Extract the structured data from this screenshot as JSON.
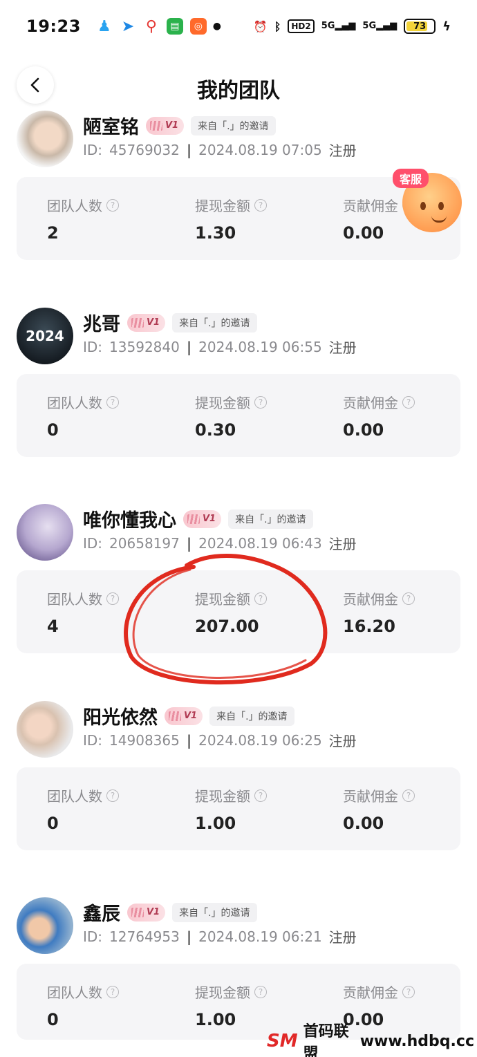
{
  "statusbar": {
    "time": "19:23",
    "notif_icons": [
      "qq-icon",
      "arrow-icon",
      "map-pin-icon",
      "message-icon",
      "app-icon",
      "dot-icon"
    ],
    "hd": "HD2",
    "sig1": "5G",
    "sig2": "5G",
    "battery": "73",
    "battery_level": 0.73
  },
  "header": {
    "title": "我的团队"
  },
  "customer_service": {
    "label": "客服"
  },
  "stat_labels": {
    "team_count": "团队人数",
    "withdraw": "提现金额",
    "commission": "贡献佣金"
  },
  "members": [
    {
      "name": "陋室铭",
      "level": "V1",
      "invite": "来自「.」的邀请",
      "id_label": "ID:",
      "id": "45769032",
      "sep": "|",
      "datetime": "2024.08.19 07:05",
      "reg": "注册",
      "team_count": "2",
      "withdraw": "1.30",
      "commission": "0.00",
      "avatar_text": ""
    },
    {
      "name": "兆哥",
      "level": "V1",
      "invite": "来自「.」的邀请",
      "id_label": "ID:",
      "id": "13592840",
      "sep": "|",
      "datetime": "2024.08.19 06:55",
      "reg": "注册",
      "team_count": "0",
      "withdraw": "0.30",
      "commission": "0.00",
      "avatar_text": "2024"
    },
    {
      "name": "唯你懂我心",
      "level": "V1",
      "invite": "来自「.」的邀请",
      "id_label": "ID:",
      "id": "20658197",
      "sep": "|",
      "datetime": "2024.08.19 06:43",
      "reg": "注册",
      "team_count": "4",
      "withdraw": "207.00",
      "commission": "16.20",
      "avatar_text": ""
    },
    {
      "name": "阳光依然",
      "level": "V1",
      "invite": "来自「.」的邀请",
      "id_label": "ID:",
      "id": "14908365",
      "sep": "|",
      "datetime": "2024.08.19 06:25",
      "reg": "注册",
      "team_count": "0",
      "withdraw": "1.00",
      "commission": "0.00",
      "avatar_text": ""
    },
    {
      "name": "鑫辰",
      "level": "V1",
      "invite": "来自「.」的邀请",
      "id_label": "ID:",
      "id": "12764953",
      "sep": "|",
      "datetime": "2024.08.19 06:21",
      "reg": "注册",
      "team_count": "0",
      "withdraw": "1.00",
      "commission": "0.00",
      "avatar_text": ""
    }
  ],
  "watermark": {
    "logo": "SM",
    "text": "首码联盟",
    "url": "www.hdbq.cc"
  },
  "colors": {
    "accent": "#ff4f6b",
    "annotation": "#e02a1e",
    "badge": "#f9c7cf",
    "card_bg": "#f5f5f7"
  }
}
